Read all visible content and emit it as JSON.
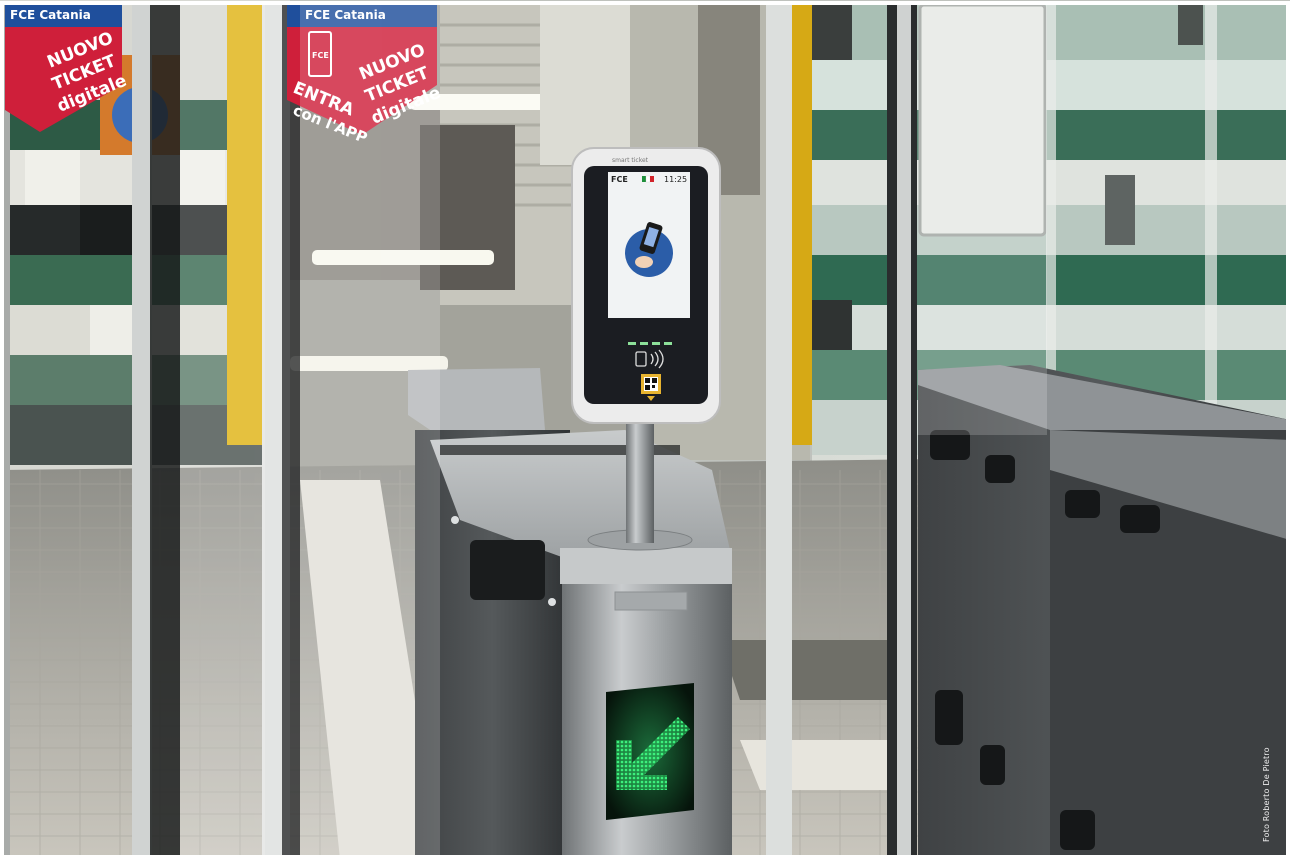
{
  "photo": {
    "subject": "Metro ticket validator gate",
    "credit": "Foto Roberto De Pietro"
  },
  "signs": {
    "banner_text": "FCE Catania",
    "line1": "NUOVO",
    "line2": "TICKET",
    "line3": "digitale",
    "cta1": "ENTRA",
    "cta2": "con l'APP",
    "logo": "FCE"
  },
  "validator": {
    "brand": "smart ticket",
    "screen_operator": "FCE",
    "screen_time": "11:25"
  },
  "colors": {
    "sign_red": "#cf1f3a",
    "sign_blue": "#1f4f9c",
    "arrow_green": "#2fe06a",
    "tile_green": "#3a6b52",
    "pillar_yellow": "#e0b415",
    "steel": "#b8bcbf"
  },
  "icons": {
    "screen_icon": "phone-tap-icon",
    "nfc_icon": "contactless-icon",
    "qr_icon": "qr-code-icon",
    "arrow_icon": "arrow-down-left-icon"
  }
}
